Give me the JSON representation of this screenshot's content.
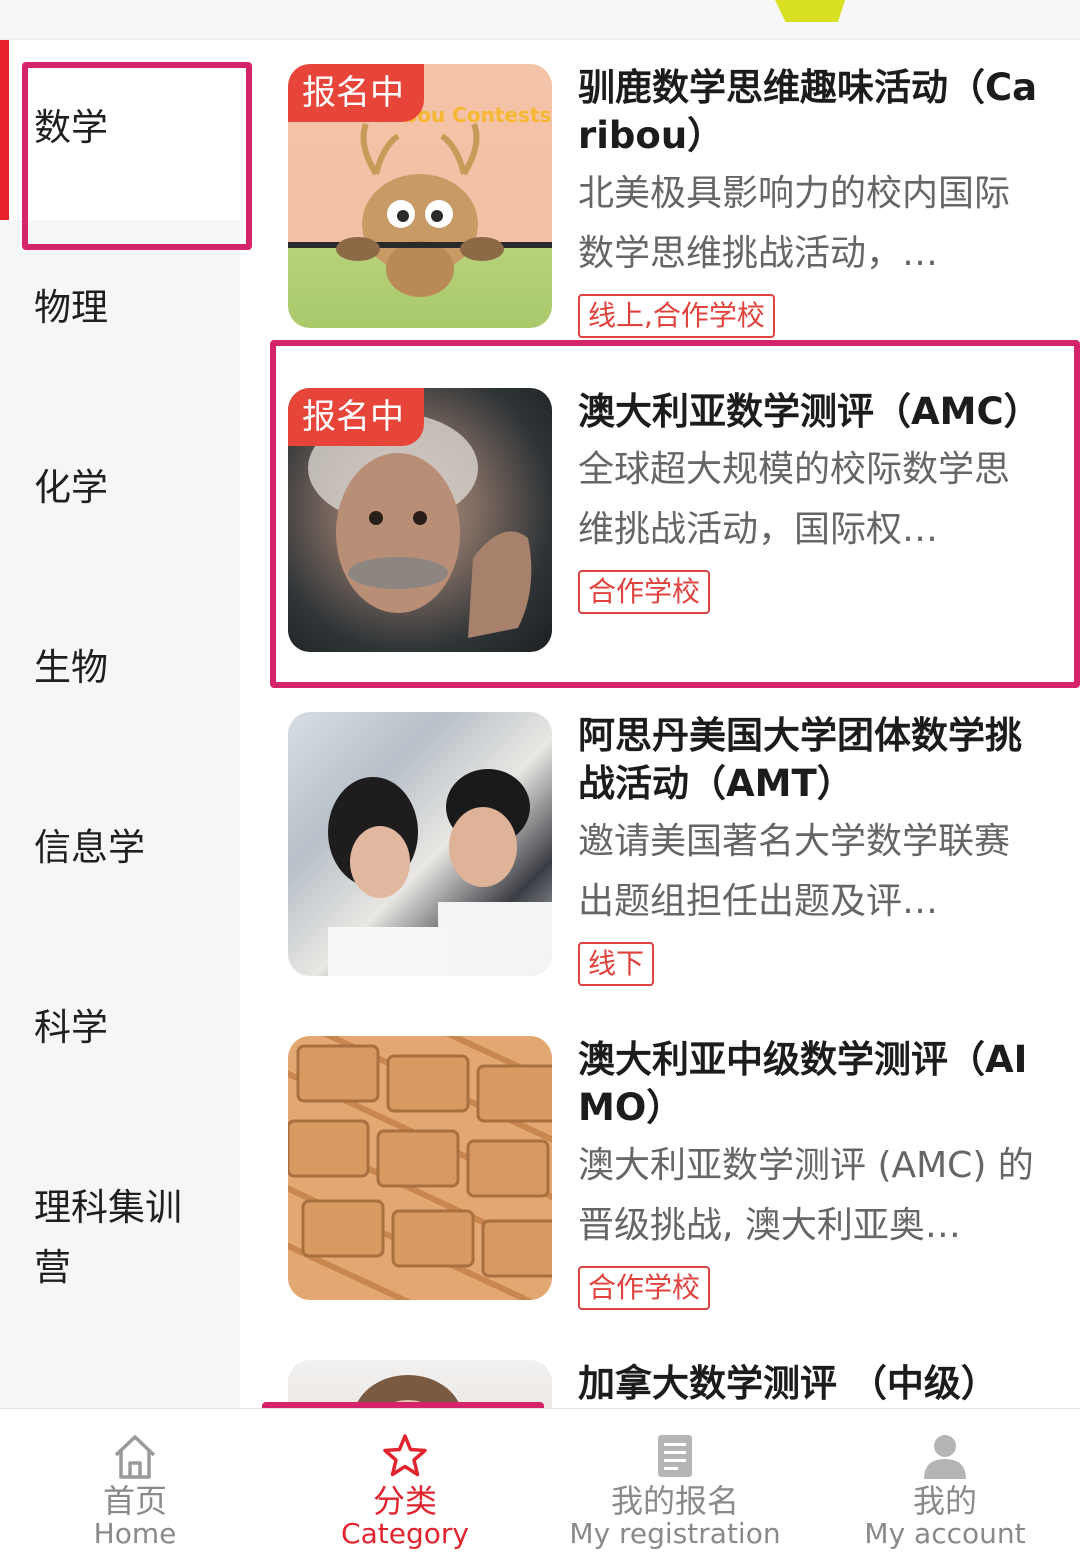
{
  "sidebar": {
    "items": [
      {
        "label": "数学"
      },
      {
        "label": "物理"
      },
      {
        "label": "化学"
      },
      {
        "label": "生物"
      },
      {
        "label": "信息学"
      },
      {
        "label": "科学"
      },
      {
        "label": "理科集训营"
      }
    ]
  },
  "cards": [
    {
      "badge": "报名中",
      "title": "驯鹿数学思维趣味活动（Caribou）",
      "desc": "北美极具影响力的校内国际数学思维挑战活动，…",
      "tag": "线上,合作学校",
      "image": "caribou-contests-cartoon"
    },
    {
      "badge": "报名中",
      "title": "澳大利亚数学测评（AMC）",
      "desc": "全球超大规模的校际数学思维挑战活动，国际权…",
      "tag": "合作学校",
      "image": "portrait-photo"
    },
    {
      "badge": "",
      "title": "阿思丹美国大学团体数学挑战活动（AMT）",
      "desc": "邀请美国著名大学数学联赛出题组担任出题及评…",
      "tag": "线下",
      "image": "students-studying-photo"
    },
    {
      "badge": "",
      "title": "澳大利亚中级数学测评（AIMO）",
      "desc": "澳大利亚数学测评 (AMC) 的晋级挑战, 澳大利亚奥…",
      "tag": "合作学校",
      "image": "wooden-multiplication-blocks"
    },
    {
      "badge": "",
      "title": "加拿大数学测评 （中级）",
      "desc": "",
      "tag": "",
      "image": "woman-photo"
    }
  ],
  "thumb_text": {
    "caribou_banner": "Caribou Contests"
  },
  "bottom_nav": [
    {
      "zh": "首页",
      "en": "Home",
      "icon": "home-icon"
    },
    {
      "zh": "分类",
      "en": "Category",
      "icon": "star-icon"
    },
    {
      "zh": "我的报名",
      "en": "My registration",
      "icon": "registration-icon"
    },
    {
      "zh": "我的",
      "en": "My account",
      "icon": "user-icon"
    }
  ],
  "colors": {
    "accent": "#e0252f",
    "highlight": "#d6246b",
    "badge": "#e8453a"
  }
}
